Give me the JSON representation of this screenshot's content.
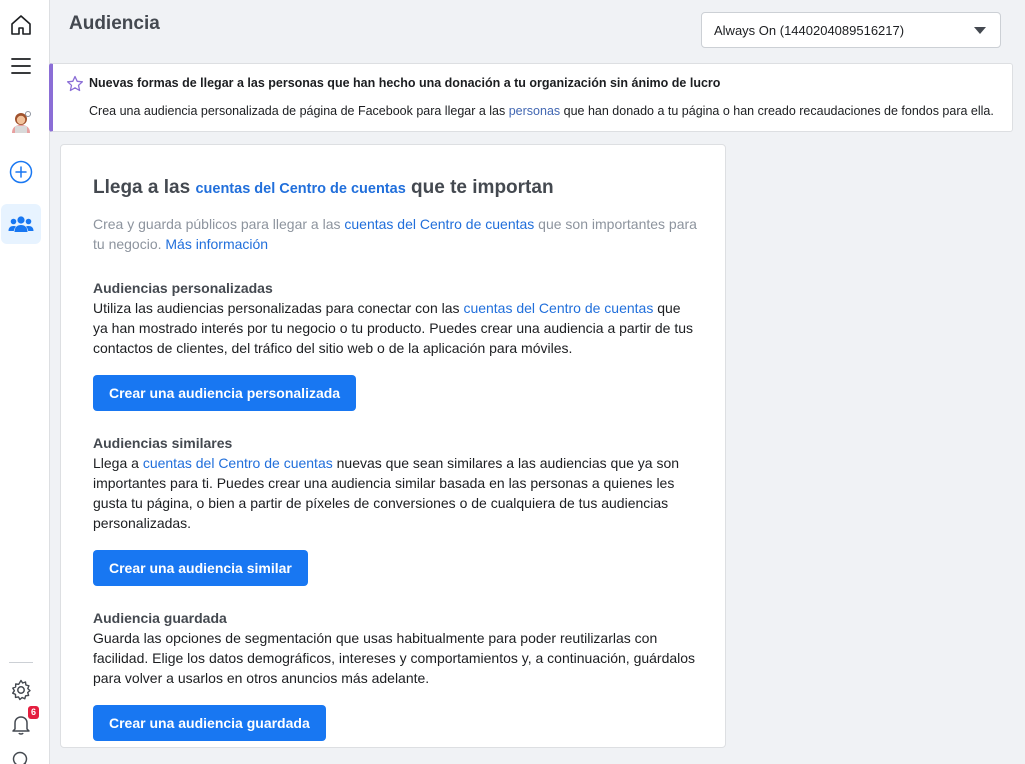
{
  "header": {
    "title": "Audiencia",
    "account_selector": "Always On (1440204089516217)"
  },
  "sidebar": {
    "icons": [
      "home-icon",
      "menu-icon",
      "profile-avatar",
      "create-icon",
      "audiences-icon",
      "settings-icon",
      "notifications-icon",
      "search-icon"
    ],
    "notification_count": "6"
  },
  "banner": {
    "title": "Nuevas formas de llegar a las personas que han hecho una donación a tu organización sin ánimo de lucro",
    "text_before": "Crea una audiencia personalizada de página de Facebook para llegar a las ",
    "link": "personas",
    "text_after": " que han donado a tu página o han creado recaudaciones de fondos para ella."
  },
  "card": {
    "heading_before": "Llega a las ",
    "heading_link": "cuentas del Centro de cuentas",
    "heading_after": " que te importan",
    "intro_before": "Crea y guarda públicos para llegar a las ",
    "intro_link": "cuentas del Centro de cuentas",
    "intro_after": " que son importantes para tu negocio. ",
    "intro_more": "Más información",
    "custom": {
      "title": "Audiencias personalizadas",
      "text_before": "Utiliza las audiencias personalizadas para conectar con las ",
      "link": "cuentas del Centro de cuentas",
      "text_after": " que ya han mostrado interés por tu negocio o tu producto. Puedes crear una audiencia a partir de tus contactos de clientes, del tráfico del sitio web o de la aplicación para móviles.",
      "button": "Crear una audiencia personalizada"
    },
    "lookalike": {
      "title": "Audiencias similares",
      "text_before": "Llega a ",
      "link": "cuentas del Centro de cuentas",
      "text_after": " nuevas que sean similares a las audiencias que ya son importantes para ti. Puedes crear una audiencia similar basada en las personas a quienes les gusta tu página, o bien a partir de píxeles de conversiones o de cualquiera de tus audiencias personalizadas.",
      "button": "Crear una audiencia similar"
    },
    "saved": {
      "title": "Audiencia guardada",
      "text": "Guarda las opciones de segmentación que usas habitualmente para poder reutilizarlas con facilidad. Elige los datos demográficos, intereses y comportamientos y, a continuación, guárdalos para volver a usarlos en otros anuncios más adelante.",
      "button": "Crear una audiencia guardada"
    }
  },
  "colors": {
    "primary": "#1877f2",
    "link": "#216fdb",
    "banner_accent": "#8b6ed6",
    "badge": "#e41e3f"
  }
}
